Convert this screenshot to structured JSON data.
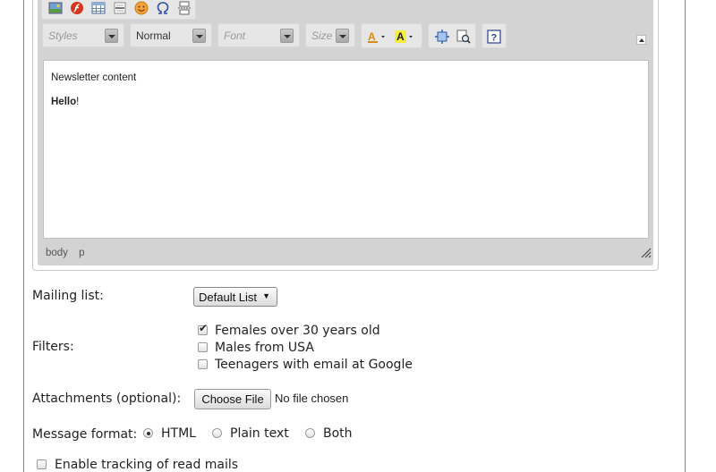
{
  "editor": {
    "toolbar_icons": [
      "image-icon",
      "flash-icon",
      "table-icon",
      "horizontal-line-icon",
      "smiley-icon",
      "omega-icon",
      "page-break-icon"
    ],
    "format_icons": [
      "text-color-icon",
      "background-color-icon",
      "maximize-icon",
      "show-blocks-icon",
      "help-icon"
    ],
    "styles_placeholder": "Styles",
    "format_value": "Normal",
    "font_placeholder": "Font",
    "size_placeholder": "Size",
    "content": {
      "heading": "Newsletter content",
      "greeting_bold": "Hello",
      "greeting_rest": "!"
    },
    "elements_path": [
      "body",
      "p"
    ]
  },
  "form": {
    "mailing_list_label": "Mailing list:",
    "mailing_list_value": "Default List",
    "filters_label": "Filters:",
    "filters": [
      {
        "label": "Females over 30 years old",
        "checked": true
      },
      {
        "label": "Males from USA",
        "checked": false
      },
      {
        "label": "Teenagers with email at Google",
        "checked": false
      }
    ],
    "attachments_label": "Attachments (optional):",
    "choose_file_label": "Choose File",
    "file_status": "No file chosen",
    "message_format_label": "Message format:",
    "formats": [
      {
        "label": "HTML",
        "selected": true
      },
      {
        "label": "Plain text",
        "selected": false
      },
      {
        "label": "Both",
        "selected": false
      }
    ],
    "tracking_label": "Enable tracking of read mails",
    "tracking_checked": false
  }
}
